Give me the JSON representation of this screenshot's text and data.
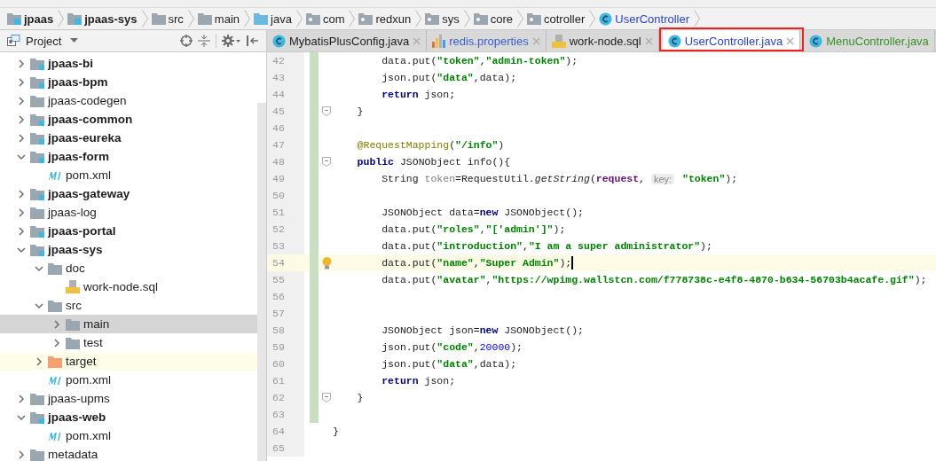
{
  "breadcrumbs": [
    {
      "label": "jpaas",
      "kind": "module"
    },
    {
      "label": "jpaas-sys",
      "kind": "module"
    },
    {
      "label": "src",
      "kind": "folder"
    },
    {
      "label": "main",
      "kind": "folder"
    },
    {
      "label": "java",
      "kind": "source"
    },
    {
      "label": "com",
      "kind": "package"
    },
    {
      "label": "redxun",
      "kind": "package"
    },
    {
      "label": "sys",
      "kind": "package"
    },
    {
      "label": "core",
      "kind": "package"
    },
    {
      "label": "cotroller",
      "kind": "package"
    },
    {
      "label": "UserController",
      "kind": "class"
    }
  ],
  "project_panel": {
    "title": "Project",
    "tree": [
      {
        "label": "jpaas-bi",
        "kind": "module",
        "expanded": false,
        "selected": false
      },
      {
        "label": "jpaas-bpm",
        "kind": "module",
        "expanded": false,
        "selected": false
      },
      {
        "label": "jpaas-codegen",
        "kind": "folder",
        "expanded": false,
        "selected": false
      },
      {
        "label": "jpaas-common",
        "kind": "module",
        "expanded": false,
        "selected": false
      },
      {
        "label": "jpaas-eureka",
        "kind": "module",
        "expanded": false,
        "selected": false
      },
      {
        "label": "jpaas-form",
        "kind": "module",
        "expanded": true,
        "selected": false,
        "children": [
          {
            "label": "pom.xml",
            "kind": "maven",
            "selected": false
          }
        ]
      },
      {
        "label": "jpaas-gateway",
        "kind": "module",
        "expanded": false,
        "selected": false
      },
      {
        "label": "jpaas-log",
        "kind": "folder",
        "expanded": false,
        "selected": false
      },
      {
        "label": "jpaas-portal",
        "kind": "module",
        "expanded": false,
        "selected": false
      },
      {
        "label": "jpaas-sys",
        "kind": "module",
        "expanded": true,
        "selected": false,
        "children": [
          {
            "label": "doc",
            "kind": "folder",
            "expanded": true,
            "selected": false,
            "children": [
              {
                "label": "work-node.sql",
                "kind": "sql",
                "selected": false
              }
            ]
          },
          {
            "label": "src",
            "kind": "folder",
            "expanded": true,
            "selected": false,
            "children": [
              {
                "label": "main",
                "kind": "folder",
                "expanded": false,
                "selected": true
              },
              {
                "label": "test",
                "kind": "folder",
                "expanded": false,
                "selected": false
              }
            ]
          },
          {
            "label": "target",
            "kind": "excluded",
            "expanded": false,
            "selected": false
          },
          {
            "label": "pom.xml",
            "kind": "maven",
            "selected": false
          }
        ]
      },
      {
        "label": "jpaas-upms",
        "kind": "folder",
        "expanded": false,
        "selected": false
      },
      {
        "label": "jpaas-web",
        "kind": "module",
        "expanded": true,
        "selected": false,
        "children": [
          {
            "label": "pom.xml",
            "kind": "maven",
            "selected": false
          }
        ]
      },
      {
        "label": "metadata",
        "kind": "folder",
        "expanded": false,
        "selected": false
      }
    ]
  },
  "tabs": [
    {
      "label": "MybatisPlusConfig.java",
      "kind": "class",
      "color": "#1e1e1e",
      "selected": false,
      "annotated": false
    },
    {
      "label": "redis.properties",
      "kind": "properties",
      "color": "#3a5fcd",
      "selected": false,
      "annotated": false
    },
    {
      "label": "work-node.sql",
      "kind": "sql",
      "color": "#1e1e1e",
      "selected": false,
      "annotated": false
    },
    {
      "label": "UserController.java",
      "kind": "class",
      "color": "#2a45c8",
      "selected": true,
      "annotated": true
    },
    {
      "label": "MenuController.java",
      "kind": "class",
      "color": "#3c8f2a",
      "selected": false,
      "annotated": false
    }
  ],
  "editor": {
    "lines": [
      {
        "number": "42",
        "changed": true,
        "current": false,
        "fold": false,
        "tokens": [
          {
            "kind": "text",
            "text": "        data.put("
          },
          {
            "kind": "string",
            "text": "\"token\""
          },
          {
            "kind": "text",
            "text": ","
          },
          {
            "kind": "string",
            "text": "\"admin-token\""
          },
          {
            "kind": "text",
            "text": ");"
          }
        ]
      },
      {
        "number": "43",
        "changed": true,
        "current": false,
        "fold": false,
        "tokens": [
          {
            "kind": "text",
            "text": "        json.put("
          },
          {
            "kind": "string",
            "text": "\"data\""
          },
          {
            "kind": "text",
            "text": ",data);"
          }
        ]
      },
      {
        "number": "44",
        "changed": true,
        "current": false,
        "fold": false,
        "tokens": [
          {
            "kind": "keyword",
            "text": "        return"
          },
          {
            "kind": "text",
            "text": " json;"
          }
        ]
      },
      {
        "number": "45",
        "changed": true,
        "current": false,
        "fold": true,
        "tokens": [
          {
            "kind": "text",
            "text": "    }"
          }
        ]
      },
      {
        "number": "46",
        "changed": true,
        "current": false,
        "fold": false
      },
      {
        "number": "47",
        "changed": true,
        "current": false,
        "fold": false,
        "tokens": [
          {
            "kind": "annotation",
            "text": "    @RequestMapping"
          },
          {
            "kind": "text",
            "text": "("
          },
          {
            "kind": "string",
            "text": "\"/info\""
          },
          {
            "kind": "text",
            "text": ")"
          }
        ]
      },
      {
        "number": "48",
        "changed": true,
        "current": false,
        "fold": true,
        "tokens": [
          {
            "kind": "keyword",
            "text": "    public"
          },
          {
            "kind": "text",
            "text": " JSONObject info(){"
          }
        ]
      },
      {
        "number": "49",
        "changed": true,
        "current": false,
        "fold": false,
        "tokens": [
          {
            "kind": "text",
            "text": "        String "
          },
          {
            "kind": "unused",
            "text": "token"
          },
          {
            "kind": "text",
            "text": "=RequestUtil."
          },
          {
            "kind": "method",
            "text": "getString"
          },
          {
            "kind": "text",
            "text": "("
          },
          {
            "kind": "field",
            "text": "request"
          },
          {
            "kind": "text",
            "text": ", "
          },
          {
            "kind": "hint",
            "text": "key:"
          },
          {
            "kind": "string",
            "text": " \"token\""
          },
          {
            "kind": "text",
            "text": ");"
          }
        ]
      },
      {
        "number": "50",
        "changed": true,
        "current": false,
        "fold": false
      },
      {
        "number": "51",
        "changed": true,
        "current": false,
        "fold": false,
        "tokens": [
          {
            "kind": "text",
            "text": "        JSONObject data="
          },
          {
            "kind": "keyword",
            "text": "new"
          },
          {
            "kind": "text",
            "text": " JSONObject();"
          }
        ]
      },
      {
        "number": "52",
        "changed": true,
        "current": false,
        "fold": false,
        "tokens": [
          {
            "kind": "text",
            "text": "        data.put("
          },
          {
            "kind": "string",
            "text": "\"roles\""
          },
          {
            "kind": "text",
            "text": ","
          },
          {
            "kind": "string",
            "text": "\"['admin']\""
          },
          {
            "kind": "text",
            "text": ");"
          }
        ]
      },
      {
        "number": "53",
        "changed": true,
        "current": false,
        "fold": false,
        "tokens": [
          {
            "kind": "text",
            "text": "        data.put("
          },
          {
            "kind": "string",
            "text": "\"introduction\""
          },
          {
            "kind": "text",
            "text": ","
          },
          {
            "kind": "string",
            "text": "\"I am a super administrator\""
          },
          {
            "kind": "text",
            "text": ");"
          }
        ]
      },
      {
        "number": "54",
        "changed": true,
        "current": true,
        "fold": false,
        "tokens": [
          {
            "kind": "text",
            "text": "        data.put("
          },
          {
            "kind": "string",
            "text": "\"name\""
          },
          {
            "kind": "text",
            "text": ","
          },
          {
            "kind": "string",
            "text": "\"Super Admin\""
          },
          {
            "kind": "text",
            "text": ");"
          }
        ]
      },
      {
        "number": "55",
        "changed": true,
        "current": false,
        "fold": false,
        "tokens": [
          {
            "kind": "text",
            "text": "        data.put("
          },
          {
            "kind": "string",
            "text": "\"avatar\""
          },
          {
            "kind": "text",
            "text": ","
          },
          {
            "kind": "string",
            "text": "\"https://wpimg.wallstcn.com/f778738c-e4f8-4870-b634-56703b4acafe.gif\""
          },
          {
            "kind": "text",
            "text": ");"
          }
        ]
      },
      {
        "number": "56",
        "changed": true,
        "current": false,
        "fold": false
      },
      {
        "number": "57",
        "changed": true,
        "current": false,
        "fold": false
      },
      {
        "number": "58",
        "changed": true,
        "current": false,
        "fold": false,
        "tokens": [
          {
            "kind": "text",
            "text": "        JSONObject json="
          },
          {
            "kind": "keyword",
            "text": "new"
          },
          {
            "kind": "text",
            "text": " JSONObject();"
          }
        ]
      },
      {
        "number": "59",
        "changed": true,
        "current": false,
        "fold": false,
        "tokens": [
          {
            "kind": "text",
            "text": "        json.put("
          },
          {
            "kind": "string",
            "text": "\"code\""
          },
          {
            "kind": "text",
            "text": ","
          },
          {
            "kind": "number",
            "text": "20000"
          },
          {
            "kind": "text",
            "text": ");"
          }
        ]
      },
      {
        "number": "60",
        "changed": true,
        "current": false,
        "fold": false,
        "tokens": [
          {
            "kind": "text",
            "text": "        json.put("
          },
          {
            "kind": "string",
            "text": "\"data\""
          },
          {
            "kind": "text",
            "text": ",data);"
          }
        ]
      },
      {
        "number": "61",
        "changed": true,
        "current": false,
        "fold": false,
        "tokens": [
          {
            "kind": "keyword",
            "text": "        return"
          },
          {
            "kind": "text",
            "text": " json;"
          }
        ]
      },
      {
        "number": "62",
        "changed": true,
        "current": false,
        "fold": true,
        "tokens": [
          {
            "kind": "text",
            "text": "    }"
          }
        ]
      },
      {
        "number": "63",
        "changed": true,
        "current": false,
        "fold": false
      },
      {
        "number": "64",
        "changed": false,
        "current": false,
        "fold": false,
        "tokens": [
          {
            "kind": "text",
            "text": "}"
          }
        ]
      },
      {
        "number": "65",
        "changed": false,
        "current": false,
        "fold": false
      }
    ]
  }
}
